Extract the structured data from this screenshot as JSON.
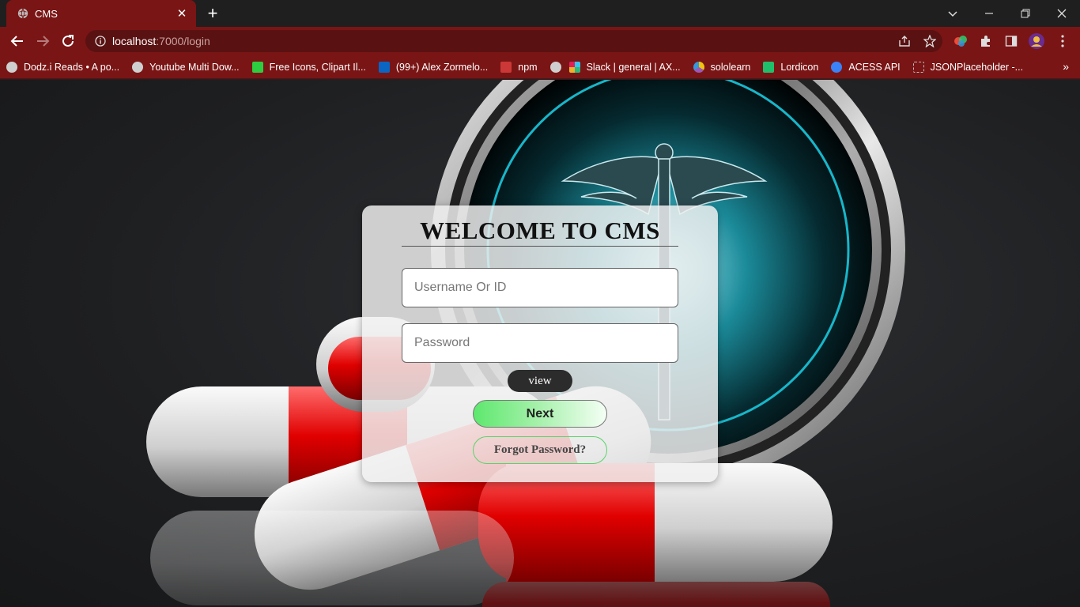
{
  "browser": {
    "tab": {
      "title": "CMS",
      "close_glyph": "✕"
    },
    "new_tab_glyph": "+",
    "address": {
      "host": "localhost",
      "path": ":7000/login"
    },
    "bookmarks": [
      {
        "label": "Dodz.i Reads • A po...",
        "icon": "globe-icon",
        "color": "#cfcfcf"
      },
      {
        "label": "Youtube Multi Dow...",
        "icon": "globe-icon",
        "color": "#cfcfcf"
      },
      {
        "label": "Free Icons, Clipart Il...",
        "icon": "freepik-icon",
        "color": "#2ecc40"
      },
      {
        "label": "(99+) Alex Zormelo...",
        "icon": "linkedin-icon",
        "color": "#0a66c2"
      },
      {
        "label": "npm",
        "icon": "npm-icon",
        "color": "#cb3837"
      },
      {
        "label": "",
        "icon": "globe-icon",
        "color": "#cfcfcf"
      },
      {
        "label": "Slack | general | AX...",
        "icon": "slack-icon",
        "color": "#e01e5a"
      },
      {
        "label": "sololearn",
        "icon": "sololearn-icon",
        "color": "#9b59b6"
      },
      {
        "label": "Lordicon",
        "icon": "lordicon-icon",
        "color": "#1fbf6b"
      },
      {
        "label": "ACESS API",
        "icon": "api-icon",
        "color": "#3b82f6"
      },
      {
        "label": "JSONPlaceholder -...",
        "icon": "json-icon",
        "color": "#bbbbbb"
      }
    ],
    "more_glyph": "»"
  },
  "login": {
    "title": "WELCOME TO CMS",
    "username_placeholder": "Username Or ID",
    "password_placeholder": "Password",
    "view_label": "view",
    "next_label": "Next",
    "forgot_label": "Forgot Password?"
  },
  "colors": {
    "chrome_accent": "#7a1515",
    "next_gradient_start": "#5ee86e",
    "forgot_border": "#5bd36a"
  }
}
